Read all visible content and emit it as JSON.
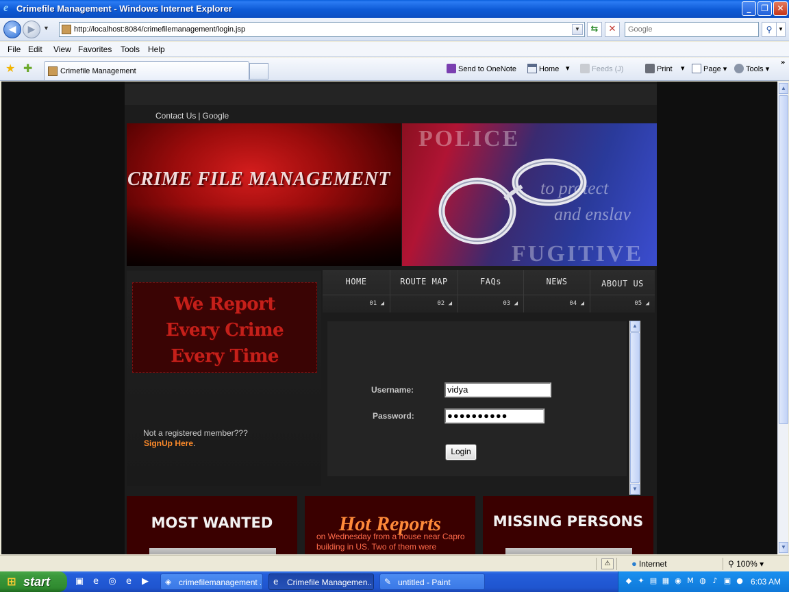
{
  "window": {
    "title": "Crimefile Management - Windows Internet Explorer",
    "minimize": "_",
    "restore": "❐",
    "close": "✕"
  },
  "toolbar": {
    "url": "http://localhost:8084/crimefilemanagement/login.jsp",
    "search_placeholder": "Google"
  },
  "menu": [
    "File",
    "Edit",
    "View",
    "Favorites",
    "Tools",
    "Help"
  ],
  "tab": {
    "label": "Crimefile Management"
  },
  "commands": {
    "onenote": "Send to OneNote",
    "home": "Home",
    "feeds": "Feeds (J)",
    "print": "Print",
    "page": "Page",
    "tools": "Tools"
  },
  "site": {
    "toplinks": {
      "contact": "Contact Us",
      "sep": "|",
      "google": "Google"
    },
    "banner_title": "CRIME FILE MANAGEMENT",
    "banner_words": [
      "POLICE",
      "to protect",
      "and enslav",
      "FUGITIVE"
    ],
    "report_lines": [
      "We Report",
      "Every Crime",
      "Every Time"
    ],
    "not_registered": "Not a registered member???",
    "signup": "SignUp Here",
    "signup_dot": ".",
    "nav": [
      {
        "label": "HOME",
        "num": "01 ◢"
      },
      {
        "label": "ROUTE MAP",
        "num": "02 ◢"
      },
      {
        "label": "FAQs",
        "num": "03 ◢"
      },
      {
        "label": "NEWS",
        "num": "04 ◢"
      },
      {
        "label": "ABOUT US",
        "num": "05 ◢"
      }
    ],
    "login": {
      "username_label": "Username:",
      "password_label": "Password:",
      "username_value": "vidya",
      "password_value": "●●●●●●●●●●",
      "button": "Login"
    },
    "boxes": {
      "most_wanted": "MOST WANTED",
      "hot_reports": "Hot Reports",
      "hot_snippet": "on Wednesday from a house near Capro building in US. Two of them were",
      "missing": "MISSING PERSONS"
    }
  },
  "status": {
    "zone": "Internet",
    "zoom": "100%"
  },
  "taskbar": {
    "start": "start",
    "tasks": [
      "crimefilemanagement ...",
      "Crimefile Managemen...",
      "untitled - Paint"
    ],
    "clock": "6:03 AM"
  },
  "colors": {
    "accent_orange": "#ff8b2a",
    "banner_red": "#9c0c0c",
    "xp_blue": "#245edb"
  }
}
